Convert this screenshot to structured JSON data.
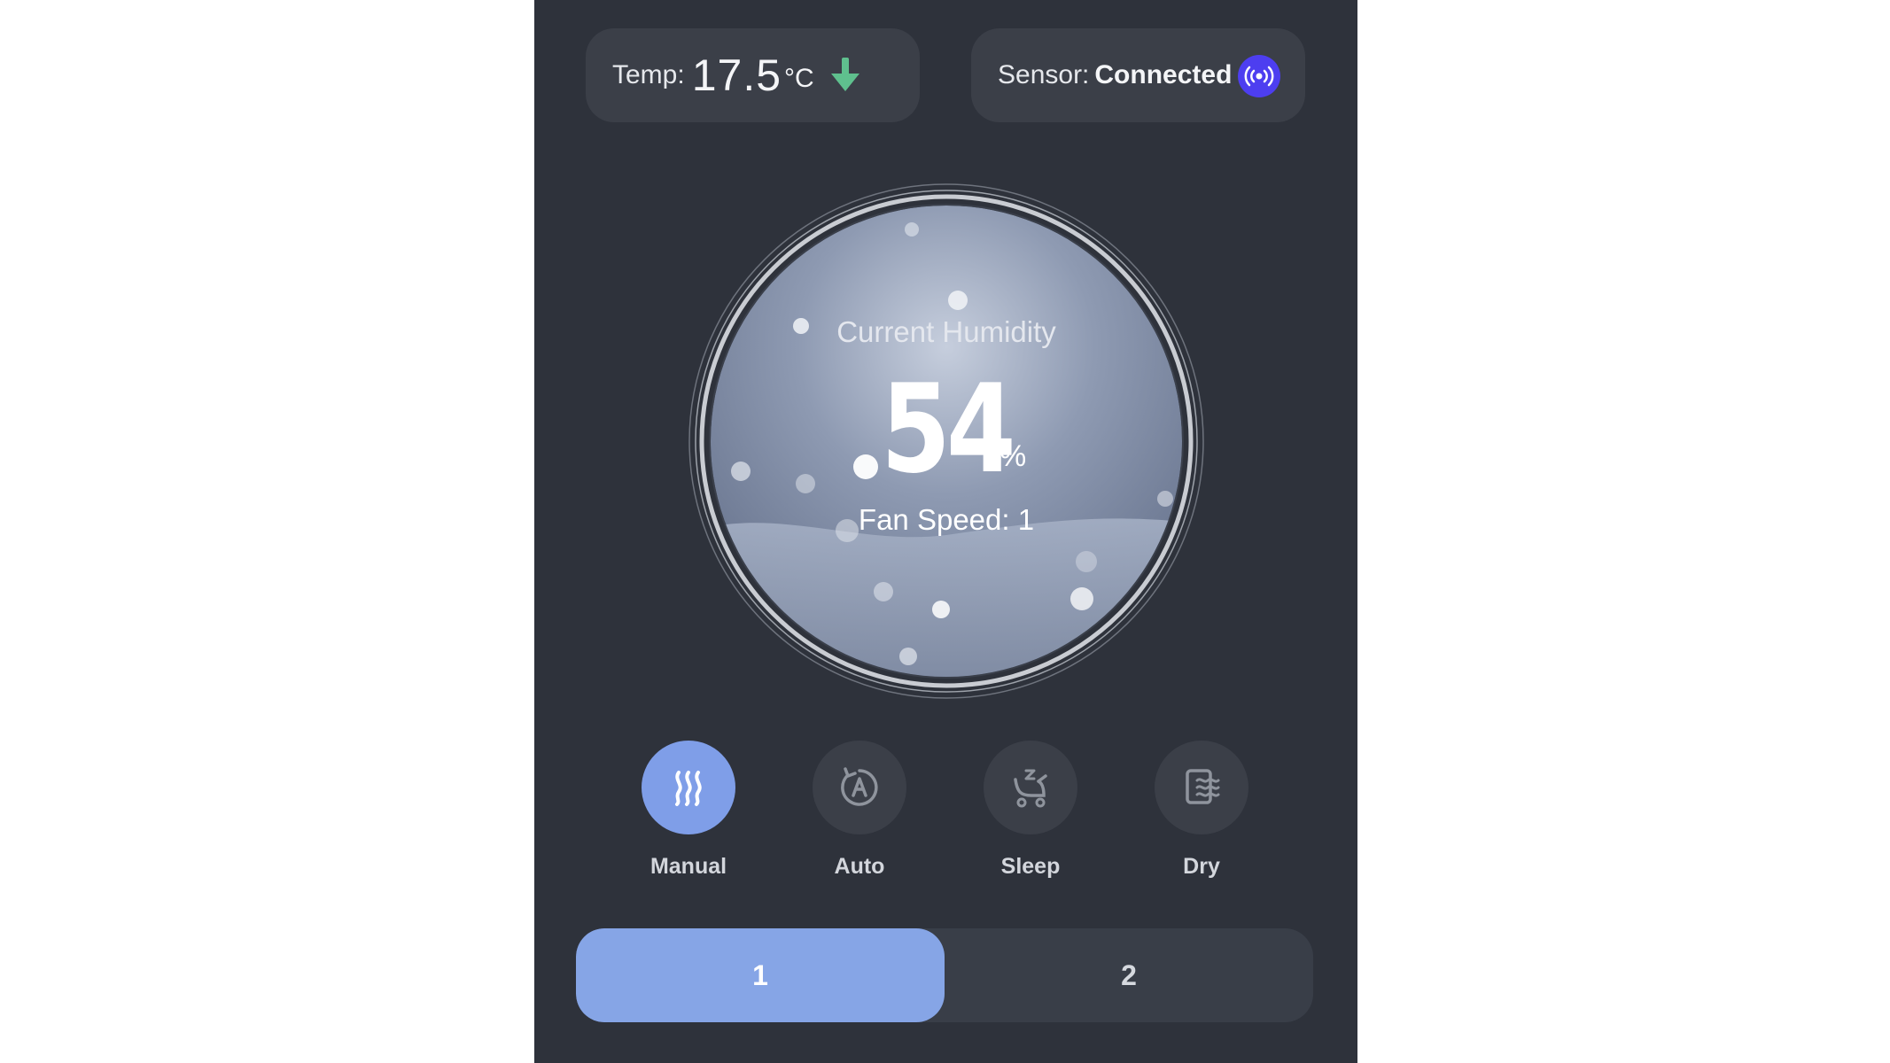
{
  "temperature": {
    "label": "Temp:",
    "value": "17.5",
    "unit": "°C",
    "trend_icon": "arrow-down-icon",
    "trend_color": "#5fc08e"
  },
  "sensor": {
    "label": "Sensor:",
    "status": "Connected",
    "icon": "signal-broadcast-icon",
    "icon_color": "#4d3ef0"
  },
  "humidity": {
    "title": "Current Humidity",
    "value": "54",
    "unit": "%",
    "fan_speed_text": "Fan Speed: 1"
  },
  "modes": [
    {
      "label": "Manual",
      "icon": "steam-icon",
      "active": true
    },
    {
      "label": "Auto",
      "icon": "auto-mode-icon",
      "active": false
    },
    {
      "label": "Sleep",
      "icon": "stroller-icon",
      "active": false
    },
    {
      "label": "Dry",
      "icon": "dry-clothes-icon",
      "active": false
    }
  ],
  "fan_speeds": {
    "options": [
      "1",
      "2"
    ],
    "selected": "1"
  },
  "colors": {
    "accent": "#86a5e6",
    "panel_bg": "#2e323b",
    "card_bg": "#3b3f48"
  }
}
